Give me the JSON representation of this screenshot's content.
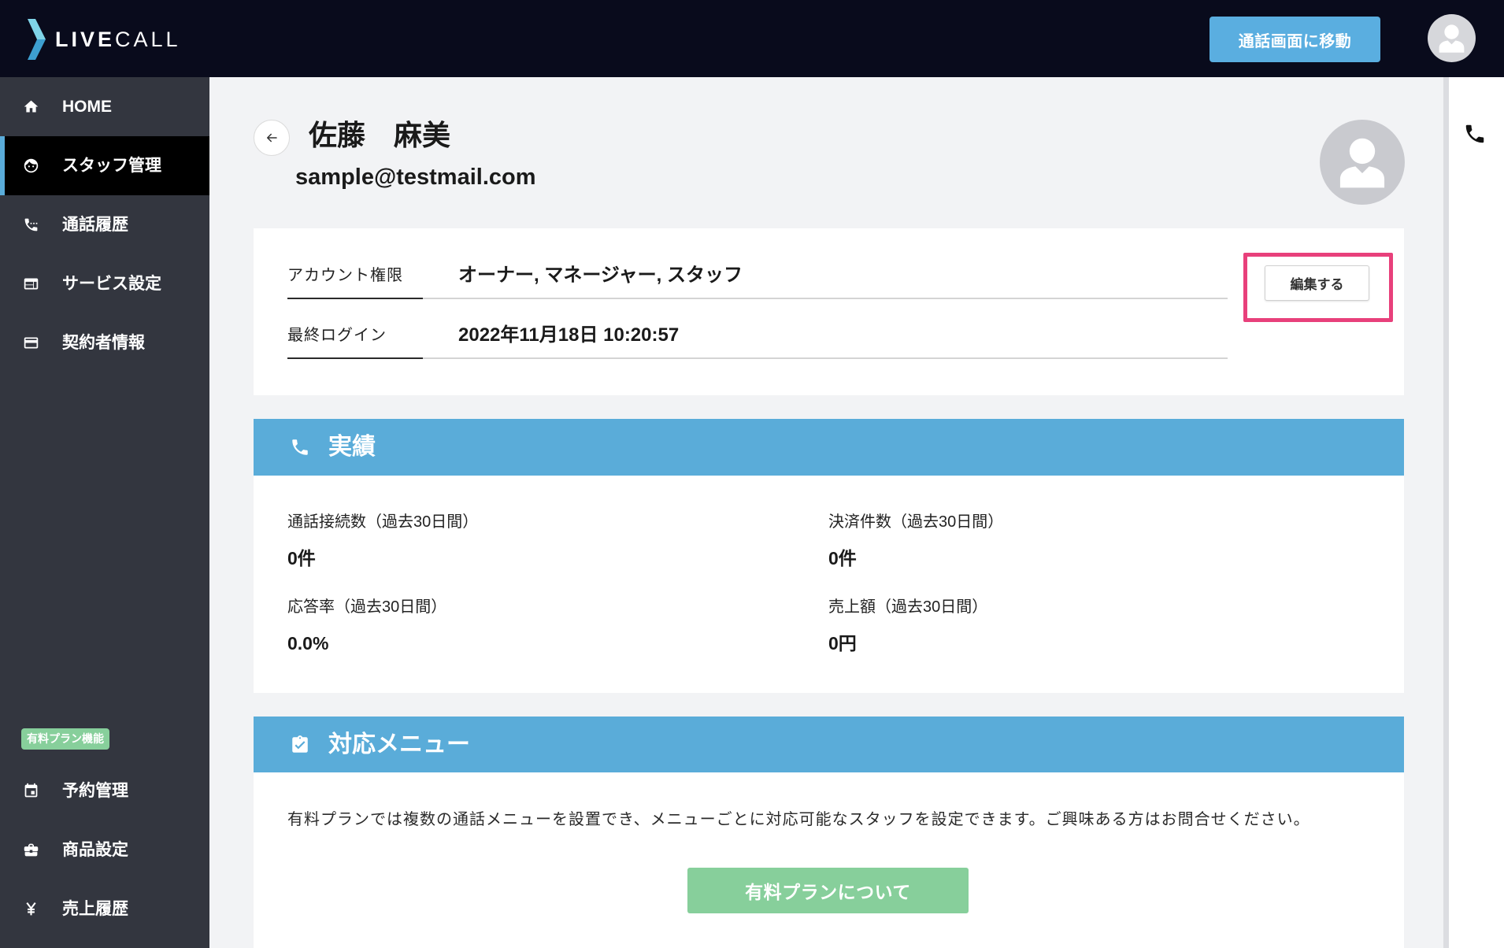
{
  "colors": {
    "header_bg": "#090b1c",
    "header_button": "#5aaee0",
    "sidebar_bg": "#33363f",
    "active_bg": "#000000",
    "accent_blue": "#5aacd9",
    "paid_green": "#87cf9b",
    "highlight_pink": "#e8407b",
    "main_bg": "#f2f3f5"
  },
  "logo": {
    "part1": "LIVE",
    "part2": "CALL"
  },
  "header": {
    "call_screen_button": "通話画面に移動",
    "avatar_icon": "user-avatar-icon"
  },
  "sidebar": {
    "items": [
      {
        "icon": "home-icon",
        "label": "HOME",
        "active": false
      },
      {
        "icon": "staff-face-icon",
        "label": "スタッフ管理",
        "active": true
      },
      {
        "icon": "phone-history-icon",
        "label": "通話履歴",
        "active": false
      },
      {
        "icon": "service-settings-icon",
        "label": "サービス設定",
        "active": false
      },
      {
        "icon": "credit-card-icon",
        "label": "契約者情報",
        "active": false
      }
    ],
    "paid_badge": "有料プラン機能",
    "paid_items": [
      {
        "icon": "calendar-icon",
        "label": "予約管理"
      },
      {
        "icon": "briefcase-icon",
        "label": "商品設定"
      },
      {
        "icon": "yen-icon",
        "label": "売上履歴"
      }
    ]
  },
  "right_panel": {
    "icon": "phone-icon"
  },
  "profile": {
    "back_icon": "back-arrow-icon",
    "name": "佐藤　麻美",
    "email": "sample@testmail.com",
    "avatar_icon": "user-avatar-icon"
  },
  "account": {
    "rows": [
      {
        "label": "アカウント権限",
        "value": "オーナー, マネージャー, スタッフ"
      },
      {
        "label": "最終ログイン",
        "value": "2022年11月18日 10:20:57"
      }
    ],
    "edit_button": "編集する"
  },
  "performance": {
    "icon": "phone-icon",
    "title": "実績",
    "stats": [
      {
        "label": "通話接続数（過去30日間）",
        "value": "0件"
      },
      {
        "label": "決済件数（過去30日間）",
        "value": "0件"
      },
      {
        "label": "応答率（過去30日間）",
        "value": "0.0%"
      },
      {
        "label": "売上額（過去30日間）",
        "value": "0円"
      }
    ]
  },
  "menu": {
    "icon": "clipboard-check-icon",
    "title": "対応メニュー",
    "description": "有料プランでは複数の通話メニューを設置でき、メニューごとに対応可能なスタッフを設定できます。ご興味ある方はお問合せください。",
    "button": "有料プランについて"
  }
}
